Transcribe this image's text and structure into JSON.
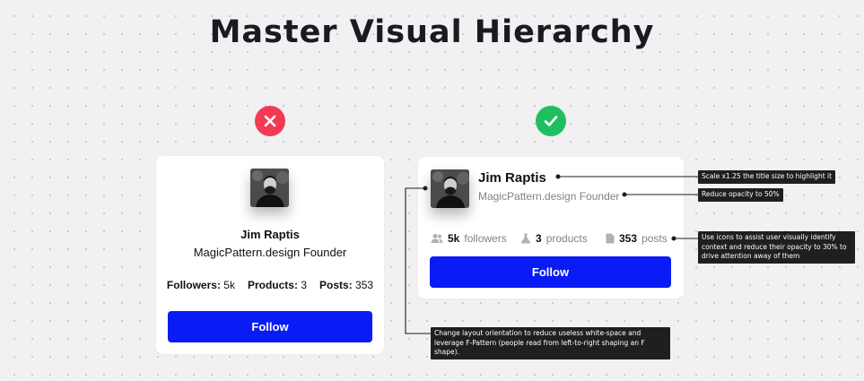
{
  "title": "Master Visual Hierarchy",
  "colors": {
    "bad": "#f23a55",
    "good": "#1fbf5f",
    "primary": "#0a1cf5"
  },
  "bad_example": {
    "status_icon": "close-icon",
    "name": "Jim Raptis",
    "subtitle": "MagicPattern.design Founder",
    "stats": [
      {
        "label": "Followers:",
        "value": "5k"
      },
      {
        "label": "Products:",
        "value": "3"
      },
      {
        "label": "Posts:",
        "value": "353"
      }
    ],
    "button_label": "Follow"
  },
  "good_example": {
    "status_icon": "check-icon",
    "name": "Jim Raptis",
    "subtitle": "MagicPattern.design Founder",
    "stats": [
      {
        "icon": "users-icon",
        "value": "5k",
        "label": "followers"
      },
      {
        "icon": "flask-icon",
        "value": "3",
        "label": "products"
      },
      {
        "icon": "document-icon",
        "value": "353",
        "label": "posts"
      }
    ],
    "button_label": "Follow"
  },
  "annotations": {
    "title_scale": "Scale x1.25 the title size to highlight it",
    "opacity": "Reduce opacity to 50%",
    "icons": "Use icons to assist user visually identify context and reduce their opacity to 30% to drive attention away of them",
    "layout": "Change layout orientation to reduce useless white-space and leverage F-Pattern (people read from left-to-right shaping an F shape)."
  }
}
